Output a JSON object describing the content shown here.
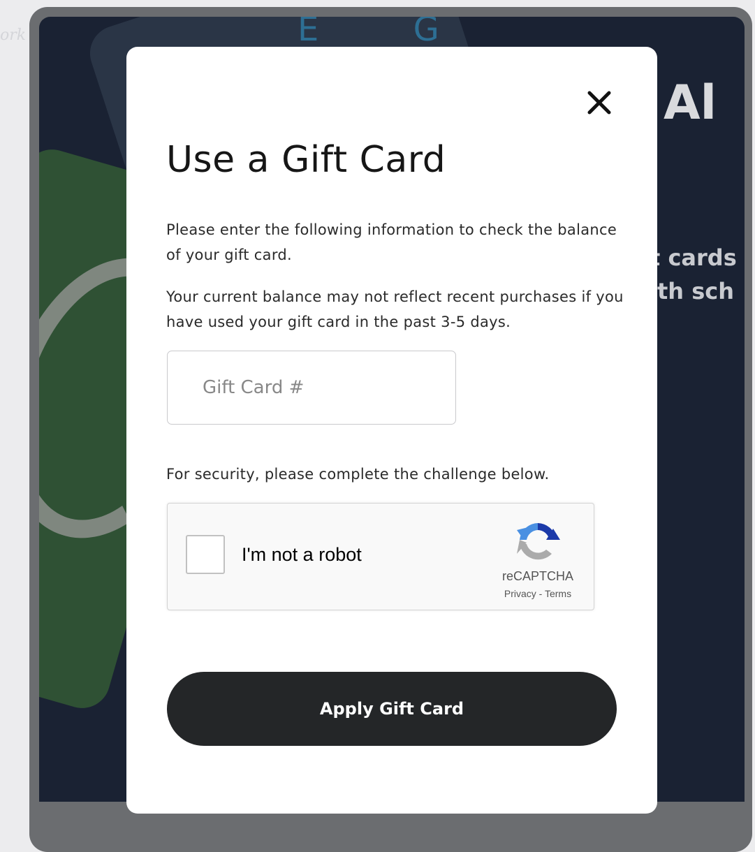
{
  "background": {
    "heading_fragment": "Al",
    "line1_fragment": "t cards",
    "line2_fragment": "ith sch",
    "left_edge_fragment": "ork",
    "card_letters": "E G"
  },
  "modal": {
    "close_icon": "close-icon",
    "title": "Use a Gift Card",
    "paragraph1": "Please enter the following information to check the balance of your gift card.",
    "paragraph2": "Your current balance may not reflect recent purchases if you have used your gift card in the past 3-5 days.",
    "gift_card_input": {
      "placeholder": "Gift Card #",
      "value": ""
    },
    "security_text": "For security, please complete the challenge below.",
    "recaptcha": {
      "label": "I'm not a robot",
      "brand": "reCAPTCHA",
      "privacy_link": "Privacy",
      "separator": " - ",
      "terms_link": "Terms",
      "logo_icon": "recaptcha-logo-icon",
      "colors": {
        "blue": "#1c3aa9",
        "light_blue": "#4a90e2",
        "gray": "#ababab"
      }
    },
    "apply_button": "Apply Gift Card"
  },
  "colors": {
    "overlay_frame": "#6b6d70",
    "page_background": "#1a2233",
    "modal_background": "#ffffff",
    "button_background": "#242628",
    "button_text": "#ffffff"
  }
}
